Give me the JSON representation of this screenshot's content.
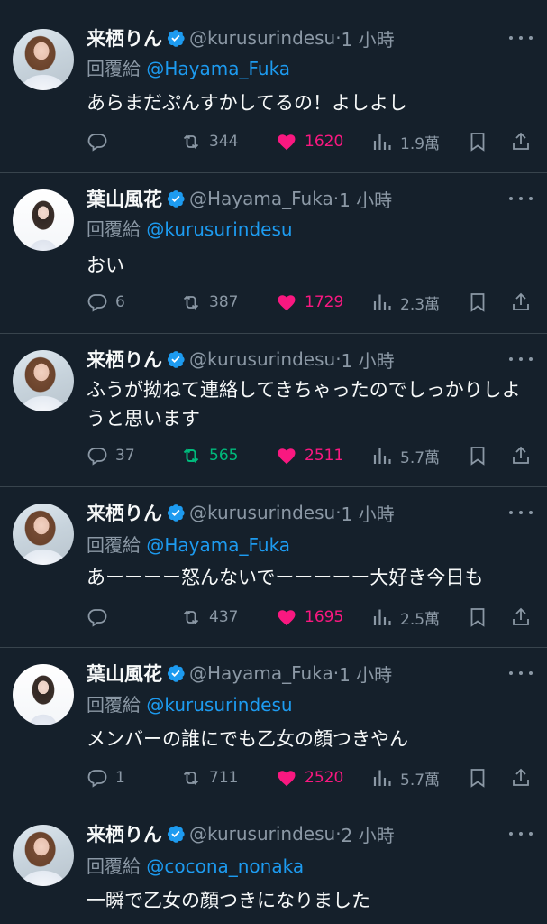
{
  "colors": {
    "background": "#15202b",
    "text": "#f7f9f9",
    "muted": "#8b98a5",
    "link": "#1d9bf0",
    "like": "#f91880",
    "retweet": "#00ba7c",
    "verified": "#1d9bf0"
  },
  "reply_prefix": "回覆給",
  "icons": {
    "reply": "reply-icon",
    "retweet": "retweet-icon",
    "like": "heart-icon",
    "views": "views-icon",
    "bookmark": "bookmark-icon",
    "share": "share-icon",
    "more": "more-icon",
    "verified": "verified-badge-icon"
  },
  "tweets": [
    {
      "author": "来栖りん",
      "handle": "@kurusurindesu",
      "time": "1 小時",
      "reply_to": "@Hayama_Fuka",
      "text": "あらまだぷんすかしてるの！よしよし",
      "replies": "",
      "retweets": "344",
      "likes": "1620",
      "views": "1.9萬",
      "liked": true,
      "retweeted": false
    },
    {
      "author": "葉山風花",
      "handle": "@Hayama_Fuka",
      "time": "1 小時",
      "reply_to": "@kurusurindesu",
      "text": "おい",
      "replies": "6",
      "retweets": "387",
      "likes": "1729",
      "views": "2.3萬",
      "liked": true,
      "retweeted": false
    },
    {
      "author": "来栖りん",
      "handle": "@kurusurindesu",
      "time": "1 小時",
      "reply_to": "",
      "text": "ふうが拗ねて連絡してきちゃったのでしっかりしようと思います",
      "replies": "37",
      "retweets": "565",
      "likes": "2511",
      "views": "5.7萬",
      "liked": true,
      "retweeted": true
    },
    {
      "author": "来栖りん",
      "handle": "@kurusurindesu",
      "time": "1 小時",
      "reply_to": "@Hayama_Fuka",
      "text": "あーーーー怒んないでーーーーー大好き今日も",
      "replies": "",
      "retweets": "437",
      "likes": "1695",
      "views": "2.5萬",
      "liked": true,
      "retweeted": false
    },
    {
      "author": "葉山風花",
      "handle": "@Hayama_Fuka",
      "time": "1 小時",
      "reply_to": "@kurusurindesu",
      "text": "メンバーの誰にでも乙女の顔つきやん",
      "replies": "1",
      "retweets": "711",
      "likes": "2520",
      "views": "5.7萬",
      "liked": true,
      "retweeted": false
    },
    {
      "author": "来栖りん",
      "handle": "@kurusurindesu",
      "time": "2 小時",
      "reply_to": "@cocona_nonaka",
      "text": "一瞬で乙女の顔つきになりました",
      "replies": "",
      "retweets": "",
      "likes": "",
      "views": "",
      "liked": false,
      "retweeted": false
    }
  ]
}
